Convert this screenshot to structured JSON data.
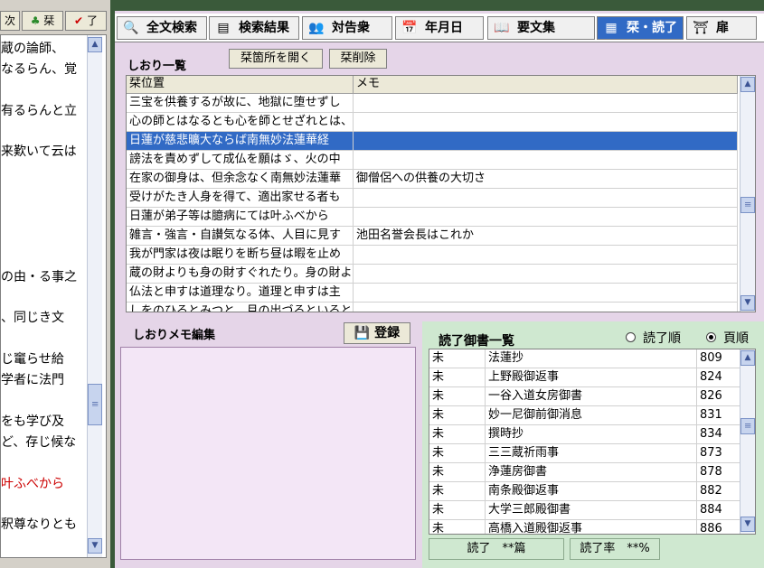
{
  "left_toolbar": {
    "next": "次",
    "clover": "栞",
    "done": "了"
  },
  "left_text": [
    {
      "text": "蔵の論師、",
      "color": "#000000"
    },
    {
      "text": "なるらん、覚",
      "color": "#000000"
    },
    {
      "text": "有るらんと立",
      "color": "#000000"
    },
    {
      "text": "来歎いて云は",
      "color": "#000000"
    },
    {
      "text": "の由・る事之",
      "color": "#000000"
    },
    {
      "text": "、同じき文",
      "color": "#000000"
    },
    {
      "text": "じ竃らせ給",
      "color": "#000000"
    },
    {
      "text": "学者に法門",
      "color": "#000000"
    },
    {
      "text": "をも学び及",
      "color": "#000000"
    },
    {
      "text": "ど、存じ候な",
      "color": "#000000"
    },
    {
      "text": "叶ふべから",
      "color": "#cc0000"
    },
    {
      "text": "釈尊なりとも",
      "color": "#000000"
    }
  ],
  "tabs": [
    {
      "label": "全文検索",
      "icon": "search-icon",
      "glyph": "🔍"
    },
    {
      "label": "検索結果",
      "icon": "list-icon",
      "glyph": "▤"
    },
    {
      "label": "対告衆",
      "icon": "people-icon",
      "glyph": "👥"
    },
    {
      "label": "年月日",
      "icon": "calendar-icon",
      "glyph": "📅"
    },
    {
      "label": "要文集",
      "icon": "book-icon",
      "glyph": "📖"
    },
    {
      "label": "栞・読了",
      "icon": "bookmark-icon",
      "glyph": "▦",
      "active": true
    },
    {
      "label": "扉",
      "icon": "gate-icon",
      "glyph": "⛩"
    }
  ],
  "bookmarks": {
    "title": "しおり一覧",
    "open_button": "栞箇所を開く",
    "delete_button": "栞削除",
    "columns": [
      "栞位置",
      "メモ"
    ],
    "rows": [
      {
        "pos": "三宝を供養するが故に、地獄に堕せずし",
        "memo": ""
      },
      {
        "pos": "心の師とはなるとも心を師とせざれとは、",
        "memo": ""
      },
      {
        "pos": "日蓮が慈悲曠大ならば南無妙法蓮華経",
        "memo": "",
        "selected": true
      },
      {
        "pos": "謗法を責めずして成仏を願はゞ、火の中",
        "memo": ""
      },
      {
        "pos": "在家の御身は、但余念なく南無妙法蓮華",
        "memo": "御僧侶への供養の大切さ"
      },
      {
        "pos": "受けがたき人身を得て、適出家せる者も",
        "memo": ""
      },
      {
        "pos": "日蓮が弟子等は臆病にては叶ふべから",
        "memo": ""
      },
      {
        "pos": "雑言・強言・自讃気なる体、人目に見す",
        "memo": "池田名誉会長はこれか"
      },
      {
        "pos": "我が門家は夜は眠りを断ち昼は暇を止め",
        "memo": ""
      },
      {
        "pos": "蔵の財よりも身の財すぐれたり。身の財よ",
        "memo": ""
      },
      {
        "pos": "仏法と申すは道理なり。道理と申すは主",
        "memo": ""
      },
      {
        "pos": "しをのひるとみつと、月の出づるといると",
        "memo": ""
      }
    ]
  },
  "memo_edit": {
    "title": "しおりメモ編集",
    "register_button": "登録"
  },
  "read_list": {
    "title": "読了御書一覧",
    "radio_done_order": "読了順",
    "radio_page_order": "頁順",
    "rows": [
      {
        "status": "未",
        "name": "法蓮抄",
        "page": "809"
      },
      {
        "status": "未",
        "name": "上野殿御返事",
        "page": "824"
      },
      {
        "status": "未",
        "name": "一谷入道女房御書",
        "page": "826"
      },
      {
        "status": "未",
        "name": "妙一尼御前御消息",
        "page": "831"
      },
      {
        "status": "未",
        "name": "撰時抄",
        "page": "834"
      },
      {
        "status": "未",
        "name": "三三蔵祈雨事",
        "page": "873"
      },
      {
        "status": "未",
        "name": "浄蓮房御書",
        "page": "878"
      },
      {
        "status": "未",
        "name": "南条殿御返事",
        "page": "882"
      },
      {
        "status": "未",
        "name": "大学三郎殿御書",
        "page": "884"
      },
      {
        "status": "未",
        "name": "高橋入道殿御返事",
        "page": "886"
      }
    ],
    "status_read": "読了　**篇",
    "status_rate": "読了率　**%"
  }
}
